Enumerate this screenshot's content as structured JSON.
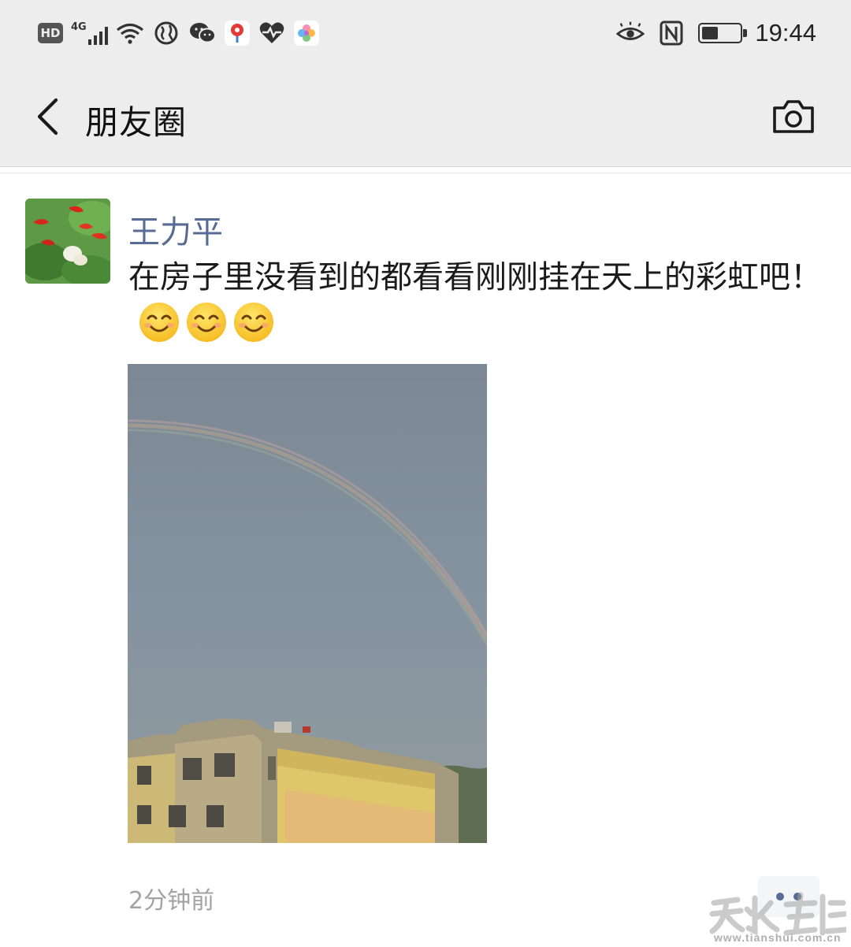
{
  "status_bar": {
    "hd_label": "HD",
    "network_label": "4G",
    "time": "19:44",
    "battery_level": 0.45,
    "left_icons": [
      "signal-icon",
      "wifi-icon",
      "globe-icon",
      "wechat-icon",
      "du-app-icon",
      "heartbeat-icon",
      "gallery-app-icon"
    ],
    "right_icons": [
      "eye-comfort-icon",
      "nfc-icon",
      "battery-icon"
    ]
  },
  "nav": {
    "title": "朋友圈",
    "back_icon": "chevron-left-icon",
    "camera_icon": "camera-icon"
  },
  "post": {
    "author": "王力平",
    "text": "在房子里没看到的都看看刚刚挂在天上的彩虹吧！",
    "emoji_count": 3,
    "emoji": "smiling-face-icon",
    "timestamp": "2分钟前"
  },
  "watermark": {
    "url": "www.tianshui.com.cn"
  },
  "colors": {
    "header_bg": "#ededed",
    "name_link": "#576b95",
    "timestamp": "#a3a3a3",
    "text": "#1a1a1a"
  }
}
